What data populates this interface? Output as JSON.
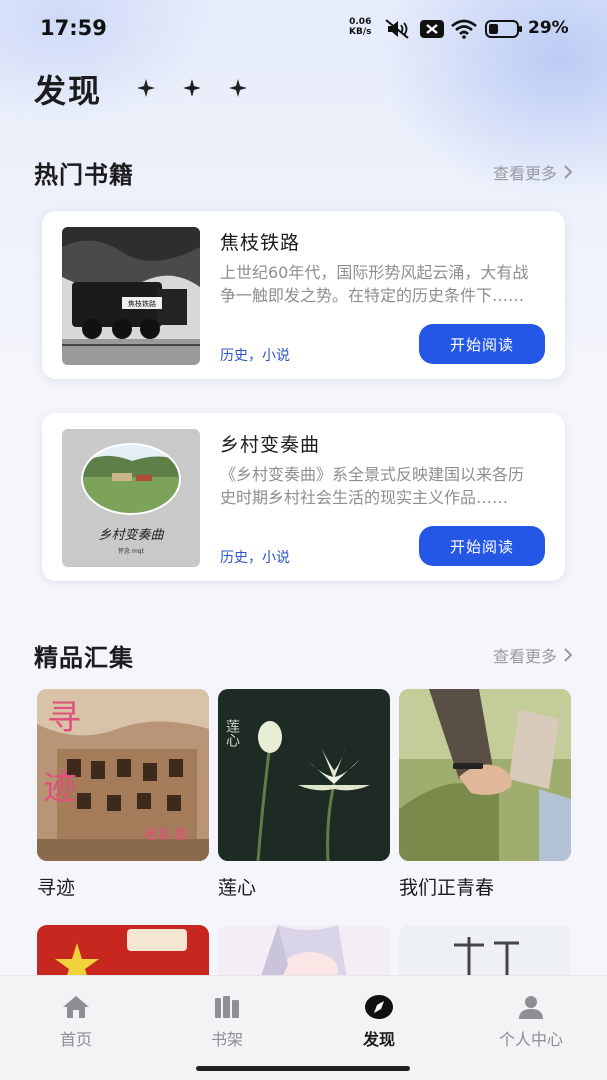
{
  "status_bar": {
    "time": "17:59",
    "net_speed_value": "0.06",
    "net_speed_unit": "KB/s",
    "battery_percent": "29%",
    "icons": [
      "mute-vibrate-icon",
      "sim-x-icon",
      "wifi-icon",
      "battery-icon"
    ]
  },
  "header": {
    "title": "发现",
    "decoration": "sparkle-icons"
  },
  "hot_books": {
    "title": "热门书籍",
    "more_label": "查看更多",
    "items": [
      {
        "title": "焦枝铁路",
        "description": "上世纪60年代，国际形势风起云涌，大有战争一触即发之势。在特定的历史条件下……",
        "tags": "历史，小说",
        "button": "开始阅读",
        "cover_text": "焦枝铁路"
      },
      {
        "title": "乡村变奏曲",
        "description": "《乡村变奏曲》系全景式反映建国以来各历史时期乡村社会生活的现实主义作品……",
        "tags": "历史，小说",
        "button": "开始阅读",
        "cover_text": "乡村变奏曲",
        "cover_subtext": "怀念 mqt"
      }
    ]
  },
  "collections": {
    "title": "精品汇集",
    "more_label": "查看更多",
    "items": [
      {
        "name": "寻迹",
        "cover_text_1": "寻",
        "cover_text_2": "迹",
        "cover_author": "老袁 著"
      },
      {
        "name": "莲心",
        "cover_text": "莲心"
      },
      {
        "name": "我们正青春"
      }
    ]
  },
  "bottom_nav": {
    "items": [
      {
        "label": "首页",
        "icon": "home-icon",
        "active": false
      },
      {
        "label": "书架",
        "icon": "bookshelf-icon",
        "active": false
      },
      {
        "label": "发现",
        "icon": "compass-icon",
        "active": true
      },
      {
        "label": "个人中心",
        "icon": "profile-icon",
        "active": false
      }
    ]
  },
  "colors": {
    "accent": "#2457e6",
    "tag": "#2a54c8",
    "muted": "#8e8e93"
  }
}
